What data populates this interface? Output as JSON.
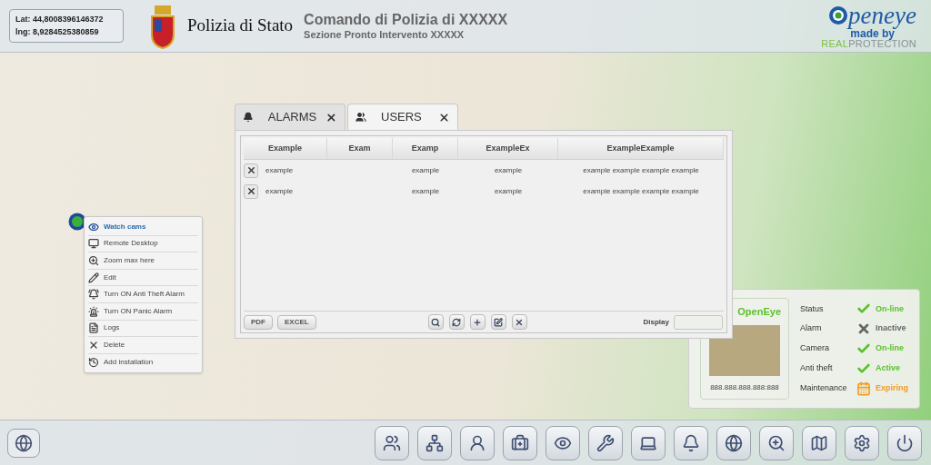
{
  "header": {
    "coordinates": {
      "lat": "Lat: 44,8008396146372",
      "lng": "lng: 8,9284525380859"
    },
    "agency": "Polizia di Stato",
    "title": "Comando di Polizia di XXXXX",
    "subtitle": "Sezione Pronto Intervento XXXXX",
    "logo": {
      "name": "peneye",
      "made_by": "made by",
      "brand_a": "REAL",
      "brand_b": "PROTECTION"
    }
  },
  "context_menu": {
    "items": [
      {
        "label": "Watch cams",
        "selected": true
      },
      {
        "label": "Remote Desktop",
        "selected": false
      },
      {
        "label": "Zoom max here",
        "selected": false
      },
      {
        "label": "Edit",
        "selected": false
      },
      {
        "label": "Turn ON Anti Theft Alarm",
        "selected": false
      },
      {
        "label": "Turn ON Panic Alarm",
        "selected": false
      },
      {
        "label": "Logs",
        "selected": false
      },
      {
        "label": "Delete",
        "selected": false
      },
      {
        "label": "Add installation",
        "selected": false
      }
    ]
  },
  "dialog": {
    "tabs": [
      {
        "label": "ALARMS",
        "selected": false
      },
      {
        "label": "USERS",
        "selected": true
      }
    ],
    "table": {
      "columns": [
        "Example",
        "Exam",
        "Examp",
        "ExampleEx",
        "ExampleExample"
      ],
      "rows": [
        {
          "cells": [
            "example",
            null,
            "example",
            "example",
            "example example example example"
          ]
        },
        {
          "cells": [
            "example",
            null,
            "example",
            "example",
            "example example example example"
          ]
        }
      ]
    },
    "export_buttons": [
      "PDF",
      "EXCEL"
    ],
    "display_label": "Display"
  },
  "info_panel": {
    "title": "OpenEye",
    "address": "888.888.888.888:888",
    "rows": [
      {
        "label": "Status",
        "value": "On-line",
        "kind": "ok",
        "color": "#5cc02a"
      },
      {
        "label": "Alarm",
        "value": "Inactive",
        "kind": "off",
        "color": "#666666"
      },
      {
        "label": "Camera",
        "value": "On-line",
        "kind": "ok",
        "color": "#5cc02a"
      },
      {
        "label": "Anti theft",
        "value": "Active",
        "kind": "ok",
        "color": "#5cc02a"
      },
      {
        "label": "Maintenance",
        "value": "Expiring",
        "kind": "warn",
        "color": "#f39a1e"
      }
    ]
  }
}
